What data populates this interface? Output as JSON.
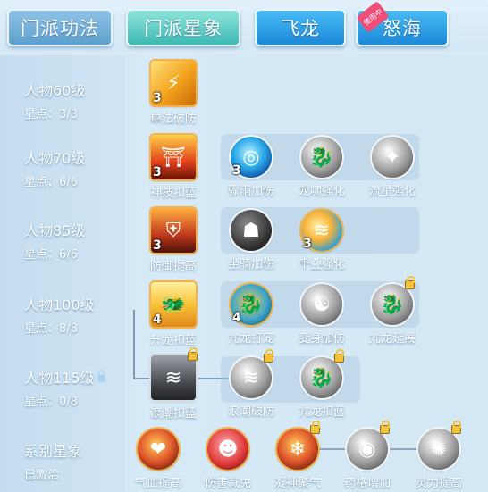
{
  "tabs": [
    {
      "label": "门派功法",
      "active": false
    },
    {
      "label": "门派星象",
      "active": true
    },
    {
      "label": "飞龙",
      "active": false
    },
    {
      "label": "怒海",
      "active": false,
      "tag": "使用中"
    }
  ],
  "levels": [
    {
      "title": "人物60级",
      "stars": "星点：3/3",
      "locked": false
    },
    {
      "title": "人物70级",
      "stars": "星点：6/6",
      "locked": false
    },
    {
      "title": "人物85级",
      "stars": "星点：6/6",
      "locked": false
    },
    {
      "title": "人物100级",
      "stars": "星点：8/8",
      "locked": false
    },
    {
      "title": "人物115级",
      "stars": "星点：0/8",
      "locked": true
    }
  ],
  "series": {
    "title": "系别星象",
    "status": "已激活"
  },
  "skills": {
    "r1": [
      {
        "label": "单法破防",
        "level": "3",
        "icon": "lightning-strike-icon"
      }
    ],
    "r2": [
      {
        "label": "神技扣蓝",
        "level": "3",
        "icon": "fire-pagoda-icon"
      },
      {
        "label": "骤雨加伤",
        "level": "3",
        "icon": "water-swirl-icon"
      },
      {
        "label": "龙啸强化",
        "level": "",
        "icon": "dragon-roar-icon"
      },
      {
        "label": "流星强化",
        "level": "",
        "icon": "meteor-icon"
      }
    ],
    "r3": [
      {
        "label": "防御提高",
        "level": "3",
        "icon": "shield-icon"
      },
      {
        "label": "坐骑加伤",
        "level": "",
        "icon": "beast-head-icon"
      },
      {
        "label": "千叠强化",
        "level": "3",
        "icon": "wave-icon"
      }
    ],
    "r4": [
      {
        "label": "升龙扣蓝",
        "level": "4",
        "icon": "rising-dragon-icon"
      },
      {
        "label": "亢龙打宠",
        "level": "4",
        "icon": "dragon-icon"
      },
      {
        "label": "变身加伤",
        "level": "",
        "icon": "meditation-icon"
      },
      {
        "label": "亢龙延展",
        "level": "",
        "icon": "dragon-coil-icon",
        "locked": true
      }
    ],
    "r5": [
      {
        "label": "浪潮扣蓝",
        "level": "",
        "icon": "tide-icon",
        "locked": true
      },
      {
        "label": "浪潮破防",
        "level": "",
        "icon": "tide-break-icon",
        "locked": true
      },
      {
        "label": "亢龙扣蓝",
        "level": "",
        "icon": "dragon-drain-icon",
        "locked": true
      }
    ],
    "series": [
      {
        "label": "气血提高",
        "icon": "heart-icon",
        "locked": false
      },
      {
        "label": "伤害减免",
        "icon": "guardian-icon",
        "locked": false
      },
      {
        "label": "凝神聚气",
        "icon": "snowflake-icon",
        "locked": true
      },
      {
        "label": "药格增加",
        "icon": "pill-icon",
        "locked": true
      },
      {
        "label": "灵力提高",
        "icon": "hand-glow-icon",
        "locked": true
      }
    ]
  },
  "colors": {
    "accent": "#3db9b4",
    "glow_line": "#ffffff",
    "tab_blue": "#1c88d9",
    "tag_pink": "#f04d78"
  }
}
